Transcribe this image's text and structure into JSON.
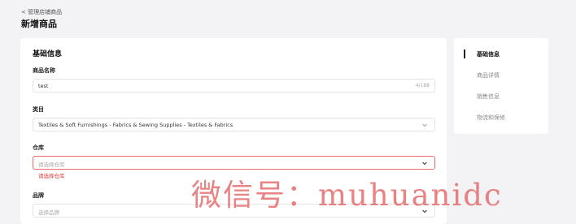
{
  "header": {
    "back_label": "< 管理店铺商品",
    "title": "新增商品"
  },
  "form": {
    "section_title": "基础信息",
    "product_name": {
      "label": "商品名称",
      "value": "test",
      "counter": "4/188"
    },
    "category": {
      "label": "类目",
      "value": "Textiles & Soft Furnishings - Fabrics & Sewing Supplies - Textiles & Fabrics"
    },
    "warehouse": {
      "label": "仓库",
      "placeholder": "请选择仓库",
      "error": "请选择仓库"
    },
    "brand": {
      "label": "品牌",
      "placeholder": "选择品牌"
    }
  },
  "side_nav": {
    "items": [
      {
        "label": "基础信息",
        "active": true
      },
      {
        "label": "商品详情"
      },
      {
        "label": "销售信息"
      },
      {
        "label": "物流和保修"
      }
    ]
  },
  "watermark": "微信号：muhuanidc",
  "colors": {
    "error": "#e23b3b",
    "error_border": "#f06a6a",
    "background": "#f3f3f5"
  },
  "icons": {
    "dropdown": "chevron-down-icon"
  }
}
